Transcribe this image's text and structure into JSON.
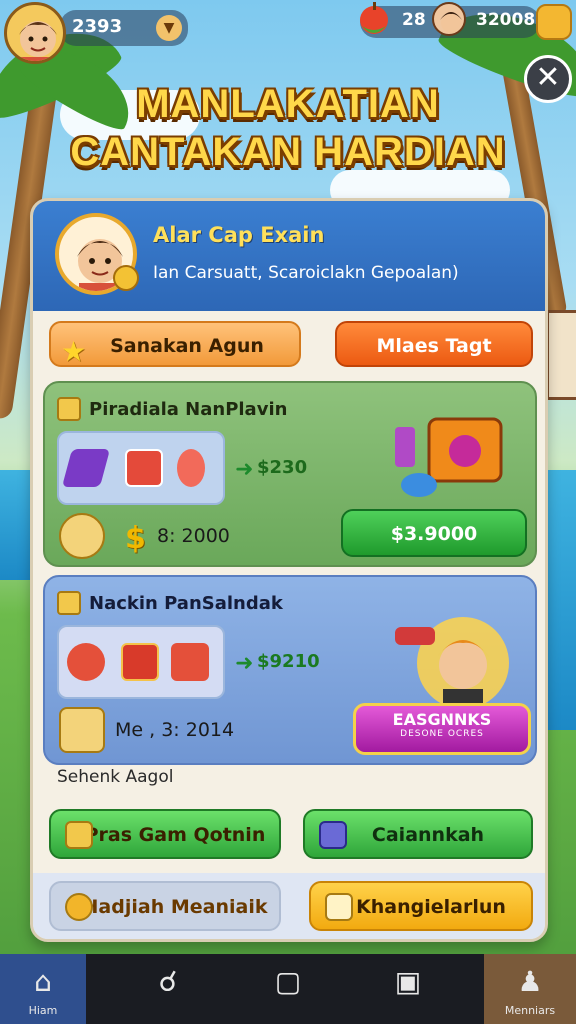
{
  "hud": {
    "level_value": "2393",
    "resource_1": "28",
    "resource_2": "32008"
  },
  "title": {
    "line1": "MANLAKATIAN",
    "line2": "CANTAKAN HARDIAN"
  },
  "profile": {
    "name": "Alar Cap Exain",
    "subtitle": "Ian Carsuatt, Scaroiclakn Gepoalan)"
  },
  "tabs": {
    "left_label": "Sanakan Agun",
    "right_label": "Mlaes Tagt"
  },
  "offer1": {
    "title": "Piradiala NanPlavin",
    "price": "$230",
    "sub_amount": "8: 2000",
    "buy_label": "$3.9000"
  },
  "offer2": {
    "title": "Nackin PanSalndak",
    "price": "$9210",
    "sub_amount": "Me , 3: 2014",
    "badge_line1": "EASGNNKS",
    "badge_line2": "DESONE OCRES",
    "footer_label": "Sehenk Aagol"
  },
  "actions": {
    "left_label": "Pras Gam Qotnin",
    "right_label": "Caiannkah",
    "row2_left_label": "Hadjiah Meaniaik",
    "row2_right_label": "Khangielarlun"
  },
  "nav": {
    "home_label": "Hiam",
    "last_label": "Menniars"
  },
  "colors": {
    "panel_header": "#3b7fd1",
    "title_yellow": "#ffd84a",
    "buy_green": "#2fa63a",
    "badge_magenta": "#c02abd",
    "tab_orange": "#ec5a12"
  },
  "icons": {
    "close": "close-icon",
    "home": "home-icon",
    "friends": "friends-icon",
    "square": "square-icon",
    "bag": "bag-icon",
    "profile": "profile-icon"
  }
}
